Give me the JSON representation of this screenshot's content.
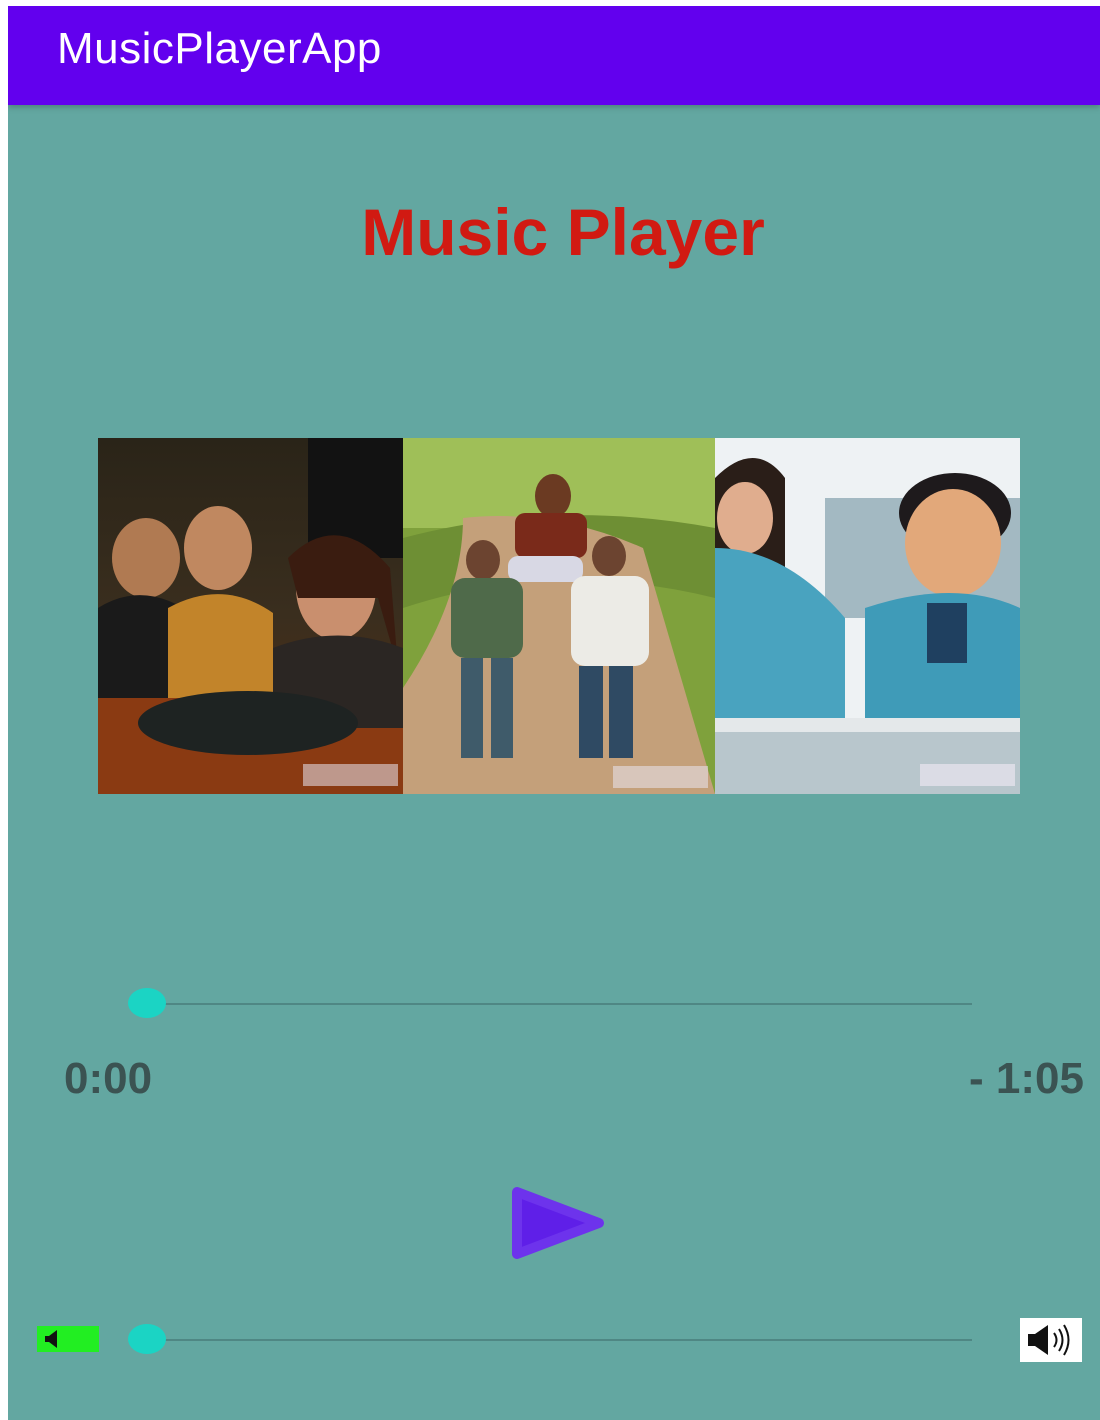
{
  "app_bar": {
    "title": "MusicPlayerApp",
    "color": "#6200ee"
  },
  "screen": {
    "background": "#63a7a1"
  },
  "header": {
    "title": "Music Player",
    "color": "#d11a12"
  },
  "album_art": {
    "panels": [
      {
        "name": "group-at-table-photo"
      },
      {
        "name": "running-friends-photo"
      },
      {
        "name": "school-friends-photo"
      }
    ]
  },
  "playback": {
    "progress": 0,
    "elapsed": "0:00",
    "remaining": "- 1:05",
    "thumb_color": "#1bd4c4"
  },
  "controls": {
    "play_icon": "play-icon",
    "play_color": "#5f1fe8"
  },
  "volume": {
    "level": 0,
    "min_icon": "volume-low-icon",
    "max_icon": "volume-high-icon"
  }
}
